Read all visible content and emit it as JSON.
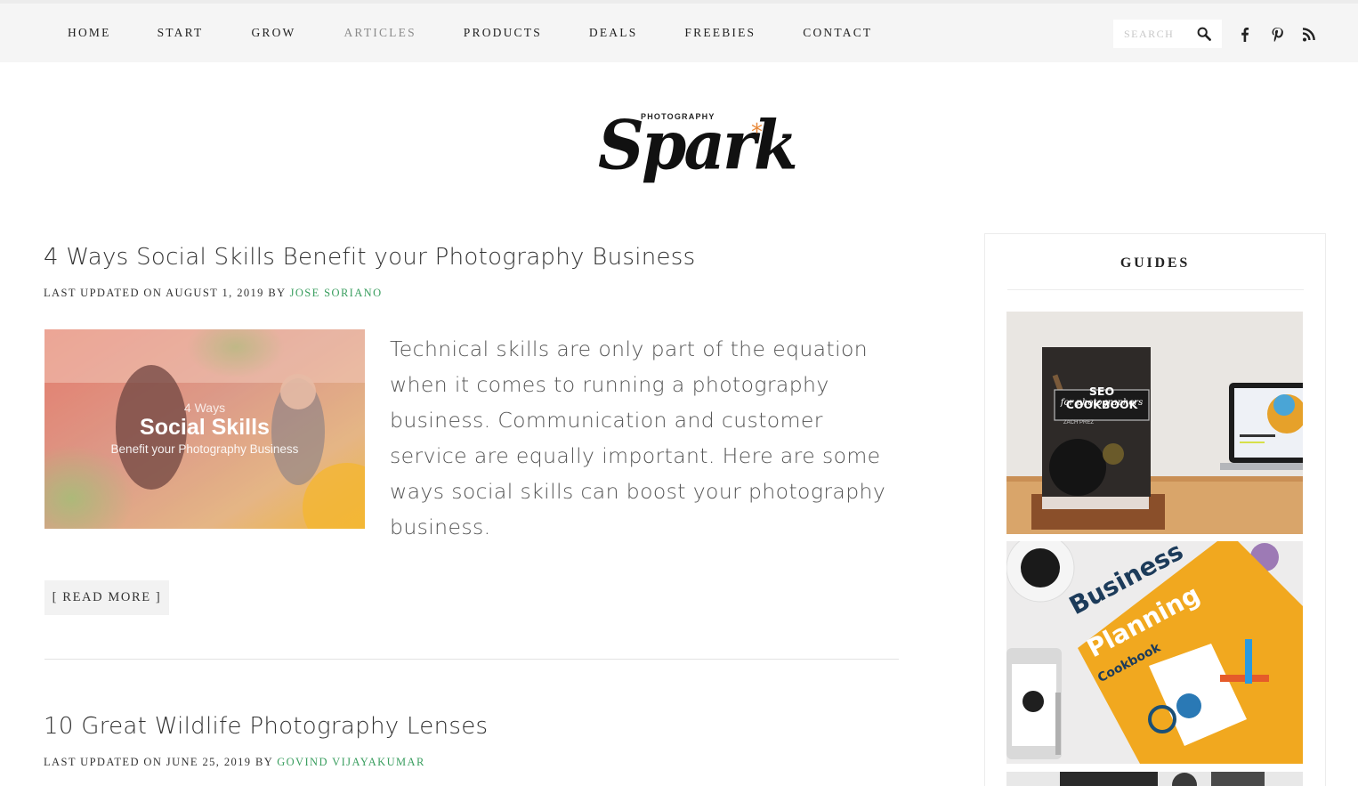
{
  "nav": {
    "items": [
      {
        "label": "HOME"
      },
      {
        "label": "START"
      },
      {
        "label": "GROW"
      },
      {
        "label": "ARTICLES"
      },
      {
        "label": "PRODUCTS"
      },
      {
        "label": "DEALS"
      },
      {
        "label": "FREEBIES"
      },
      {
        "label": "CONTACT"
      }
    ],
    "current": "ARTICLES",
    "search_placeholder": "SEARCH",
    "icons": [
      "search-icon",
      "facebook-icon",
      "pinterest-icon",
      "rss-icon"
    ]
  },
  "logo": {
    "small": "PHOTOGRAPHY",
    "script": "Spark",
    "star": "*",
    "accent_color": "#e8893a"
  },
  "posts": [
    {
      "title": "4 Ways Social Skills Benefit your Photography Business",
      "meta_prefix": "LAST UPDATED ON AUGUST 1, 2019 BY ",
      "author": "JOSE SORIANO",
      "thumb": {
        "line1": "4 Ways",
        "line2": "Social Skills",
        "line3": "Benefit your Photography Business"
      },
      "excerpt": "Technical skills are only part of the equation when it comes to running a photography business. Communication and customer service are equally important. Here are some ways social skills can boost your photography business.",
      "read_more": "[ READ MORE ]"
    },
    {
      "title": "10 Great Wildlife Photography Lenses",
      "meta_prefix": "LAST UPDATED ON JUNE 25, 2019 BY ",
      "author": "GOVIND VIJAYAKUMAR"
    }
  ],
  "sidebar": {
    "title": "GUIDES",
    "guides": [
      {
        "title_line1": "SEO COOKBOOK",
        "title_line2": "for photographers",
        "byline": "ZACH PREZ"
      },
      {
        "title_line1": "Business",
        "title_line2": "Planning",
        "title_line3": "Cookbook"
      }
    ]
  },
  "colors": {
    "author_link": "#3a9e5f",
    "nav_bg": "#f5f5f5",
    "guide2_bg": "#f1a81f"
  }
}
